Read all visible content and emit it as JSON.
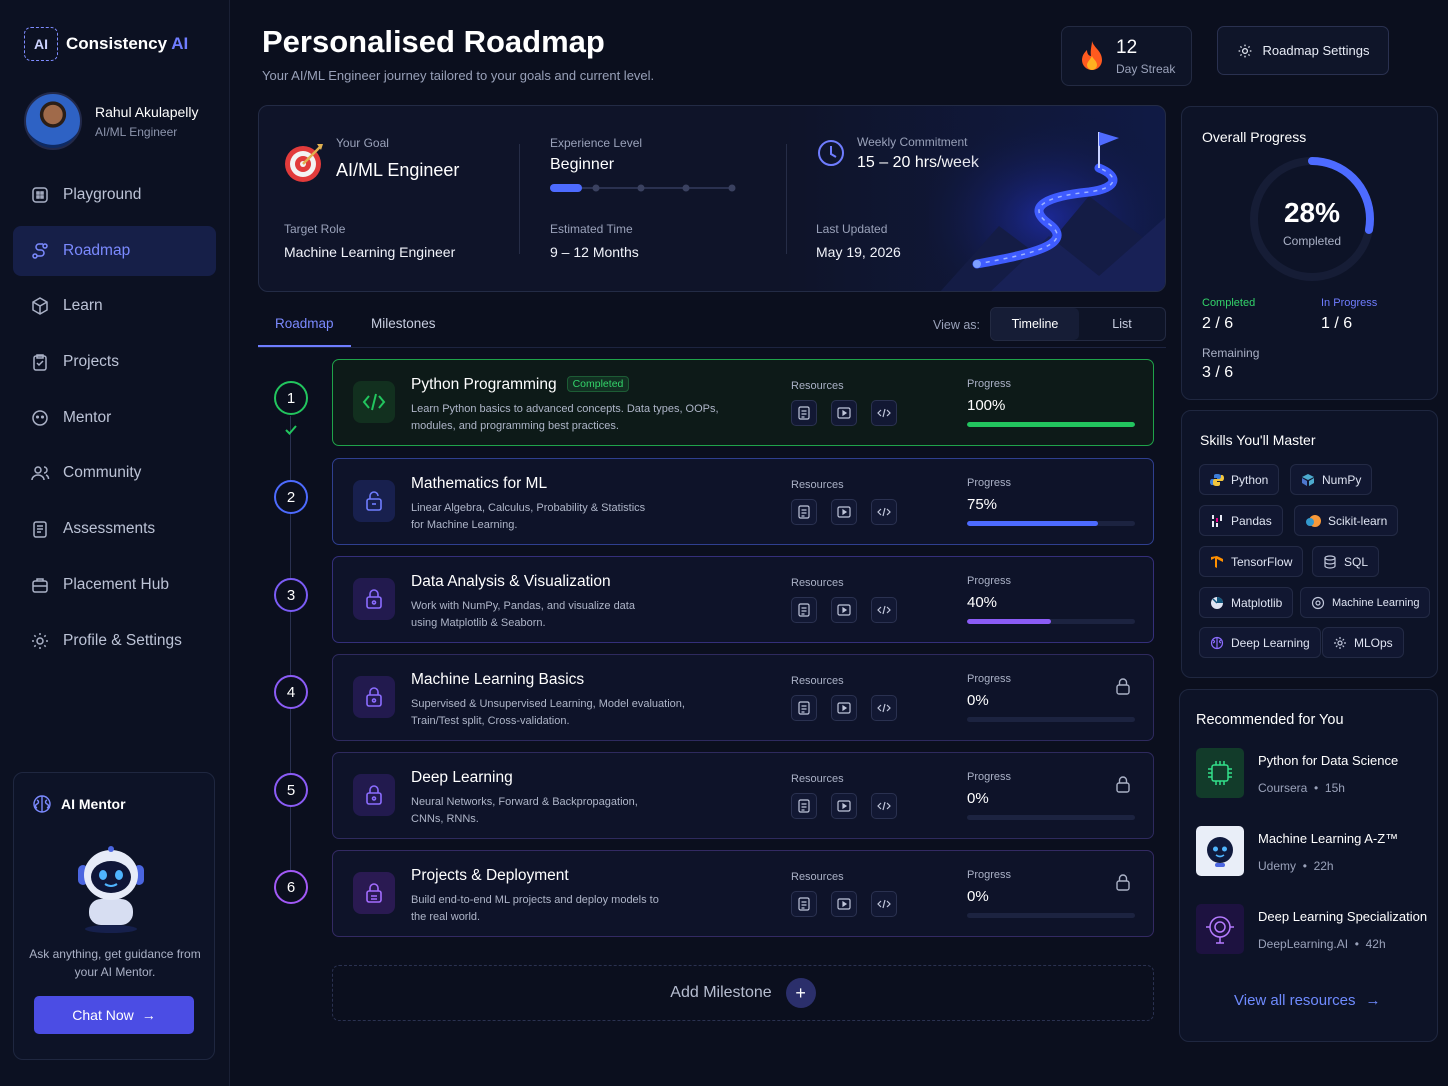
{
  "brand": {
    "name": "Consistency ",
    "accent": "AI",
    "logo_text": "AI"
  },
  "user": {
    "name": "Rahul Akulapelly",
    "role": "AI/ML Engineer"
  },
  "nav": [
    {
      "label": "Playground",
      "icon": "playground-icon"
    },
    {
      "label": "Roadmap",
      "icon": "roadmap-icon",
      "active": true
    },
    {
      "label": "Learn",
      "icon": "cube-icon"
    },
    {
      "label": "Projects",
      "icon": "clipboard-icon"
    },
    {
      "label": "Mentor",
      "icon": "mentor-icon"
    },
    {
      "label": "Community",
      "icon": "users-icon"
    },
    {
      "label": "Assessments",
      "icon": "assessment-icon"
    },
    {
      "label": "Placement Hub",
      "icon": "briefcase-icon"
    },
    {
      "label": "Profile & Settings",
      "icon": "gear-icon"
    }
  ],
  "mentor": {
    "title": "AI Mentor",
    "desc": "Ask anything, get guidance from your AI Mentor.",
    "button": "Chat Now"
  },
  "header": {
    "title": "Personalised Roadmap",
    "subtitle": "Your AI/ML Engineer journey tailored to your goals and current level."
  },
  "streak": {
    "count": "12",
    "label": "Day Streak"
  },
  "settings_button": "Roadmap Settings",
  "goal": {
    "goal_label": "Your Goal",
    "goal_value": "AI/ML Engineer",
    "target_label": "Target Role",
    "target_value": "Machine Learning Engineer",
    "exp_label": "Experience Level",
    "exp_value": "Beginner",
    "exp_level": 1,
    "exp_levels": 5,
    "time_label": "Estimated Time",
    "time_value": "9 – 12 Months",
    "weekly_label": "Weekly Commitment",
    "weekly_value": "15 – 20 hrs/week",
    "updated_label": "Last Updated",
    "updated_value": "May 19, 2026"
  },
  "tabs": {
    "roadmap": "Roadmap",
    "milestones": "Milestones",
    "view_as": "View as:",
    "timeline": "Timeline",
    "list": "List"
  },
  "milestones": [
    {
      "num": "1",
      "title": "Python Programming",
      "badge": "Completed",
      "desc": "Learn Python basics to advanced concepts. Data types, OOPs, modules, and programming best practices.",
      "progress_label": "Progress",
      "progress": "100%",
      "fill": 1.0,
      "color": "#22c55e",
      "locked": false
    },
    {
      "num": "2",
      "title": "Mathematics for ML",
      "desc": "Linear Algebra, Calculus, Probability & Statistics for Machine Learning.",
      "progress_label": "Progress",
      "progress": "75%",
      "fill": 0.78,
      "color": "#4d6bff",
      "locked": false
    },
    {
      "num": "3",
      "title": "Data Analysis & Visualization",
      "desc": "Work with NumPy, Pandas, and visualize data using Matplotlib & Seaborn.",
      "progress_label": "Progress",
      "progress": "40%",
      "fill": 0.5,
      "color": "#8b5cf6",
      "locked": false
    },
    {
      "num": "4",
      "title": "Machine Learning Basics",
      "desc": "Supervised & Unsupervised Learning, Model evaluation, Train/Test split, Cross-validation.",
      "progress_label": "Progress",
      "progress": "0%",
      "fill": 0,
      "color": "#8b5cf6",
      "locked": true
    },
    {
      "num": "5",
      "title": "Deep Learning",
      "desc": "Neural Networks, Forward & Backpropagation, CNNs, RNNs.",
      "progress_label": "Progress",
      "progress": "0%",
      "fill": 0,
      "color": "#8b5cf6",
      "locked": true
    },
    {
      "num": "6",
      "title": "Projects & Deployment",
      "desc": "Build end-to-end ML projects and deploy models to the real world.",
      "progress_label": "Progress",
      "progress": "0%",
      "fill": 0,
      "color": "#8b5cf6",
      "locked": true
    }
  ],
  "resources_label": "Resources",
  "add_milestone": "Add Milestone",
  "overall": {
    "title": "Overall Progress",
    "percent": "28%",
    "percent_value": 0.28,
    "completed_text": "Completed",
    "completed_label": "Completed",
    "completed_value": "2 / 6",
    "inprogress_label": "In Progress",
    "inprogress_value": "1 / 6",
    "remaining_label": "Remaining",
    "remaining_value": "3 / 6"
  },
  "skills": {
    "title": "Skills You'll Master",
    "items": [
      "Python",
      "NumPy",
      "Pandas",
      "Scikit-learn",
      "TensorFlow",
      "SQL",
      "Matplotlib",
      "Machine Learning",
      "Deep Learning",
      "MLOps"
    ]
  },
  "recommended": {
    "title": "Recommended for You",
    "items": [
      {
        "name": "Python for Data Science",
        "provider": "Coursera",
        "duration": "15h"
      },
      {
        "name": "Machine Learning A-Z™",
        "provider": "Udemy",
        "duration": "22h"
      },
      {
        "name": "Deep Learning Specialization",
        "provider": "DeepLearning.AI",
        "duration": "42h"
      }
    ],
    "view_all": "View all resources",
    "sep": "•"
  }
}
